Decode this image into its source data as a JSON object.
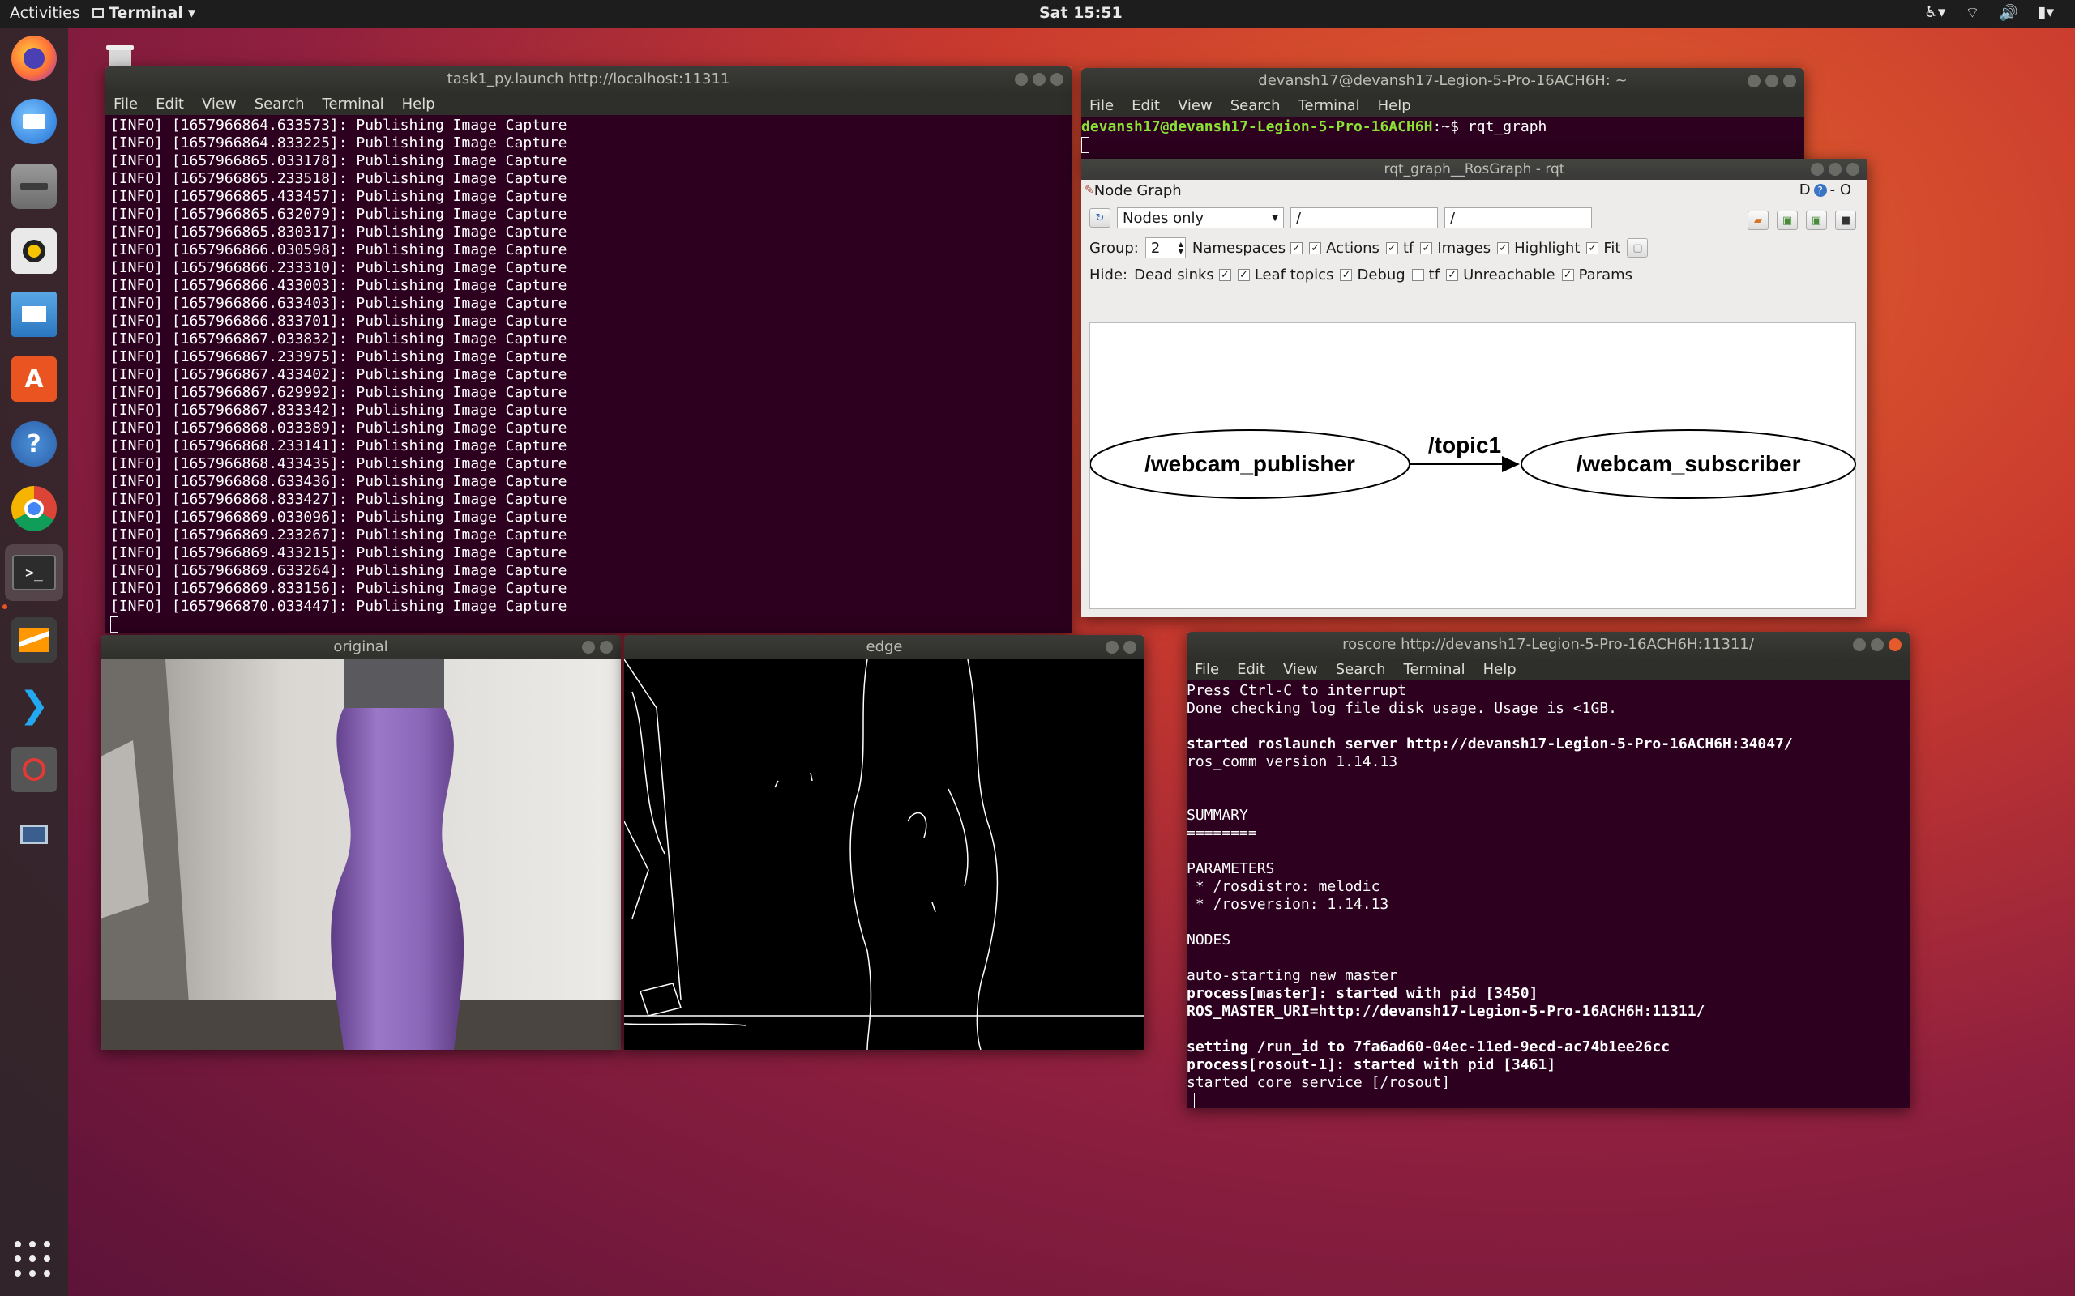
{
  "topbar": {
    "activities": "Activities",
    "app_menu": "Terminal",
    "clock": "Sat 15:51"
  },
  "dock": {
    "items": [
      "firefox-icon",
      "thunderbird-icon",
      "files-icon",
      "rhythmbox-icon",
      "libreoffice-impress-icon",
      "software-center-icon",
      "help-icon",
      "chrome-icon",
      "terminal-icon",
      "sublime-icon",
      "vscode-icon",
      "blocked-app-icon",
      "remote-desktop-icon"
    ]
  },
  "launch_term": {
    "title": "task1_py.launch http://localhost:11311",
    "menu": [
      "File",
      "Edit",
      "View",
      "Search",
      "Terminal",
      "Help"
    ],
    "lines": [
      "[INFO] [1657966864.633573]: Publishing Image Capture",
      "[INFO] [1657966864.833225]: Publishing Image Capture",
      "[INFO] [1657966865.033178]: Publishing Image Capture",
      "[INFO] [1657966865.233518]: Publishing Image Capture",
      "[INFO] [1657966865.433457]: Publishing Image Capture",
      "[INFO] [1657966865.632079]: Publishing Image Capture",
      "[INFO] [1657966865.830317]: Publishing Image Capture",
      "[INFO] [1657966866.030598]: Publishing Image Capture",
      "[INFO] [1657966866.233310]: Publishing Image Capture",
      "[INFO] [1657966866.433003]: Publishing Image Capture",
      "[INFO] [1657966866.633403]: Publishing Image Capture",
      "[INFO] [1657966866.833701]: Publishing Image Capture",
      "[INFO] [1657966867.033832]: Publishing Image Capture",
      "[INFO] [1657966867.233975]: Publishing Image Capture",
      "[INFO] [1657966867.433402]: Publishing Image Capture",
      "[INFO] [1657966867.629992]: Publishing Image Capture",
      "[INFO] [1657966867.833342]: Publishing Image Capture",
      "[INFO] [1657966868.033389]: Publishing Image Capture",
      "[INFO] [1657966868.233141]: Publishing Image Capture",
      "[INFO] [1657966868.433435]: Publishing Image Capture",
      "[INFO] [1657966868.633436]: Publishing Image Capture",
      "[INFO] [1657966868.833427]: Publishing Image Capture",
      "[INFO] [1657966869.033096]: Publishing Image Capture",
      "[INFO] [1657966869.233267]: Publishing Image Capture",
      "[INFO] [1657966869.433215]: Publishing Image Capture",
      "[INFO] [1657966869.633264]: Publishing Image Capture",
      "[INFO] [1657966869.833156]: Publishing Image Capture",
      "[INFO] [1657966870.033447]: Publishing Image Capture"
    ]
  },
  "home_term": {
    "title": "devansh17@devansh17-Legion-5-Pro-16ACH6H: ~",
    "menu": [
      "File",
      "Edit",
      "View",
      "Search",
      "Terminal",
      "Help"
    ],
    "prompt": "devansh17@devansh17-Legion-5-Pro-16ACH6H",
    "prompt_suffix": ":~$ ",
    "command": "rqt_graph"
  },
  "rqt": {
    "title": "rqt_graph__RosGraph - rqt",
    "plugin_title": "Node Graph",
    "header_right": "D",
    "header_right2": "- O",
    "mode_value": "Nodes only",
    "filter1": "/",
    "filter2": "/",
    "group_label": "Group:",
    "group_value": "2",
    "options_row1": [
      "Namespaces",
      "Actions",
      "tf",
      "Images",
      "Highlight",
      "Fit"
    ],
    "hide_label": "Hide:",
    "options_row2": [
      "Dead sinks",
      "Leaf topics",
      "Debug",
      "tf",
      "Unreachable",
      "Params"
    ],
    "graph": {
      "node1": "/webcam_publisher",
      "edge": "/topic1",
      "node2": "/webcam_subscriber"
    }
  },
  "original_win": {
    "title": "original"
  },
  "edge_win": {
    "title": "edge"
  },
  "roscore_term": {
    "title": "roscore http://devansh17-Legion-5-Pro-16ACH6H:11311/",
    "menu": [
      "File",
      "Edit",
      "View",
      "Search",
      "Terminal",
      "Help"
    ],
    "lines": [
      {
        "t": "Press Ctrl-C to interrupt",
        "b": false
      },
      {
        "t": "Done checking log file disk usage. Usage is <1GB.",
        "b": false
      },
      {
        "t": "",
        "b": false
      },
      {
        "t": "started roslaunch server http://devansh17-Legion-5-Pro-16ACH6H:34047/",
        "b": true
      },
      {
        "t": "ros_comm version 1.14.13",
        "b": false
      },
      {
        "t": "",
        "b": false
      },
      {
        "t": "",
        "b": false
      },
      {
        "t": "SUMMARY",
        "b": false
      },
      {
        "t": "========",
        "b": false
      },
      {
        "t": "",
        "b": false
      },
      {
        "t": "PARAMETERS",
        "b": false
      },
      {
        "t": " * /rosdistro: melodic",
        "b": false
      },
      {
        "t": " * /rosversion: 1.14.13",
        "b": false
      },
      {
        "t": "",
        "b": false
      },
      {
        "t": "NODES",
        "b": false
      },
      {
        "t": "",
        "b": false
      },
      {
        "t": "auto-starting new master",
        "b": false
      },
      {
        "t": "process[master]: started with pid [3450]",
        "b": true
      },
      {
        "t": "ROS_MASTER_URI=http://devansh17-Legion-5-Pro-16ACH6H:11311/",
        "b": true
      },
      {
        "t": "",
        "b": false
      },
      {
        "t": "setting /run_id to 7fa6ad60-04ec-11ed-9ecd-ac74b1ee26cc",
        "b": true
      },
      {
        "t": "process[rosout-1]: started with pid [3461]",
        "b": true
      },
      {
        "t": "started core service [/rosout]",
        "b": false
      }
    ]
  },
  "colors": {
    "terminal_bg": "#2c001e",
    "prompt_green": "#8ae234",
    "ubuntu_orange": "#e95420"
  }
}
